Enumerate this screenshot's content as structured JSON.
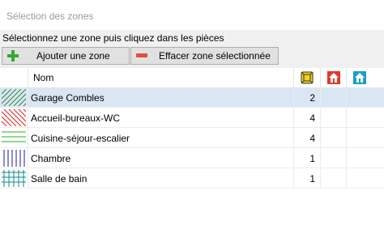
{
  "window": {
    "title": "Sélection des zones"
  },
  "instruction": "Sélectionnez une zone puis cliquez dans les pièces",
  "toolbar": {
    "add_label": "Ajouter une zone",
    "add_icon": "plus-icon",
    "delete_label": "Effacer zone sélectionnée",
    "delete_icon": "minus-icon"
  },
  "table": {
    "columns": {
      "name": "Nom",
      "icons": [
        "box-icon",
        "house-red-icon",
        "house-blue-icon"
      ]
    },
    "rows": [
      {
        "name": "Garage Combles",
        "count": "2",
        "selected": true,
        "pattern": "diagonal-right",
        "color": "#2e8b3a"
      },
      {
        "name": "Accueil-bureaux-WC",
        "count": "4",
        "selected": false,
        "pattern": "diagonal-left",
        "color": "#e02020"
      },
      {
        "name": "Cuisine-séjour-escalier",
        "count": "4",
        "selected": false,
        "pattern": "horizontal",
        "color": "#20b020"
      },
      {
        "name": "Chambre",
        "count": "1",
        "selected": false,
        "pattern": "vertical",
        "color": "#1a1aa0"
      },
      {
        "name": "Salle de bain",
        "count": "1",
        "selected": false,
        "pattern": "grid",
        "color": "#0a8a8a"
      }
    ]
  },
  "colors": {
    "selected_row": "#dae6f4",
    "button_face": "#e1e1e1"
  }
}
